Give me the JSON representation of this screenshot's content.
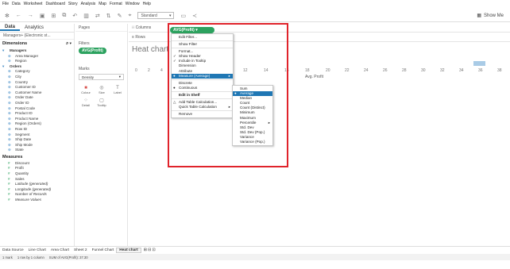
{
  "menu_bar": [
    "File",
    "Data",
    "Worksheet",
    "Dashboard",
    "Story",
    "Analysis",
    "Map",
    "Format",
    "Window",
    "Help"
  ],
  "toolbar": {
    "fit_select": "Standard",
    "show_me": "Show Me"
  },
  "data_pane": {
    "tabs": [
      "Data",
      "Analytics"
    ],
    "source": "Managers+ (Electronic st...",
    "dimensions_label": "Dimensions",
    "dimension_groups": [
      {
        "name": "Managers",
        "fields": [
          "Area Manager",
          "Region"
        ]
      },
      {
        "name": "Orders",
        "fields": [
          "Category",
          "City",
          "Country",
          "Customer ID",
          "Customer Name",
          "Order Date",
          "Order ID",
          "Postal Code",
          "Product ID",
          "Product Name",
          "Region (Orders)",
          "Row ID",
          "Segment",
          "Ship Date",
          "Ship Mode",
          "State"
        ]
      }
    ],
    "measures_label": "Measures",
    "measures": [
      "Discount",
      "Profit",
      "Quantity",
      "Sales",
      "Latitude (generated)",
      "Longitude (generated)",
      "Number of Records",
      "Measure Values"
    ]
  },
  "shelves": {
    "pages": "Pages",
    "filters": "Filters",
    "filter_pill": "AVG(Profit)",
    "marks": "Marks",
    "mark_type": "Density",
    "mark_buttons": [
      "Colour",
      "Size",
      "Label",
      "Detail",
      "Tooltip"
    ],
    "columns": "Columns",
    "rows": "Rows",
    "columns_pill": "AVG(Profit)"
  },
  "view": {
    "sheet_title": "Heat chart",
    "axis_ticks": [
      "0",
      "2",
      "4",
      "12",
      "14",
      "16",
      "18",
      "20",
      "22",
      "24",
      "26",
      "28",
      "30",
      "32",
      "34",
      "36",
      "38"
    ],
    "axis_label": "Avg. Profit"
  },
  "context_menu": [
    {
      "label": "Edit Filter..."
    },
    {
      "sep": true
    },
    {
      "label": "Show Filter"
    },
    {
      "sep": true
    },
    {
      "label": "Format..."
    },
    {
      "label": "Show Header",
      "check": "✓"
    },
    {
      "label": "Include in Tooltip",
      "check": "✓"
    },
    {
      "label": "Dimension"
    },
    {
      "label": "Attribute"
    },
    {
      "label": "Measure (Average)",
      "check": "●",
      "highlight": true,
      "arrow": "▸"
    },
    {
      "sep": true
    },
    {
      "label": "Discrete"
    },
    {
      "label": "Continuous",
      "check": "●"
    },
    {
      "sep": true
    },
    {
      "label": "Edit in Shelf",
      "bold": true
    },
    {
      "sep": true
    },
    {
      "label": "Add Table Calculation...",
      "check": "△"
    },
    {
      "label": "Quick Table Calculation",
      "arrow": "▸"
    },
    {
      "sep": true
    },
    {
      "label": "Remove"
    }
  ],
  "submenu": [
    {
      "label": "Sum"
    },
    {
      "label": "Average",
      "check": "●",
      "highlight": true
    },
    {
      "label": "Median"
    },
    {
      "label": "Count"
    },
    {
      "label": "Count (Distinct)"
    },
    {
      "label": "Minimum"
    },
    {
      "label": "Maximum"
    },
    {
      "label": "Percentile",
      "arrow": "▸"
    },
    {
      "label": "Std. Dev"
    },
    {
      "label": "Std. Dev (Pop.)"
    },
    {
      "label": "Variance"
    },
    {
      "label": "Variance (Pop.)"
    }
  ],
  "sheet_tabs": [
    "Data Source",
    "Line Chart",
    "Area Chart",
    "Sheet 2",
    "Funnel Chart",
    "Heat chart"
  ],
  "status": [
    "1 mark",
    "1 row by 1 column",
    "SUM of AVG(Profit): 37.30"
  ]
}
